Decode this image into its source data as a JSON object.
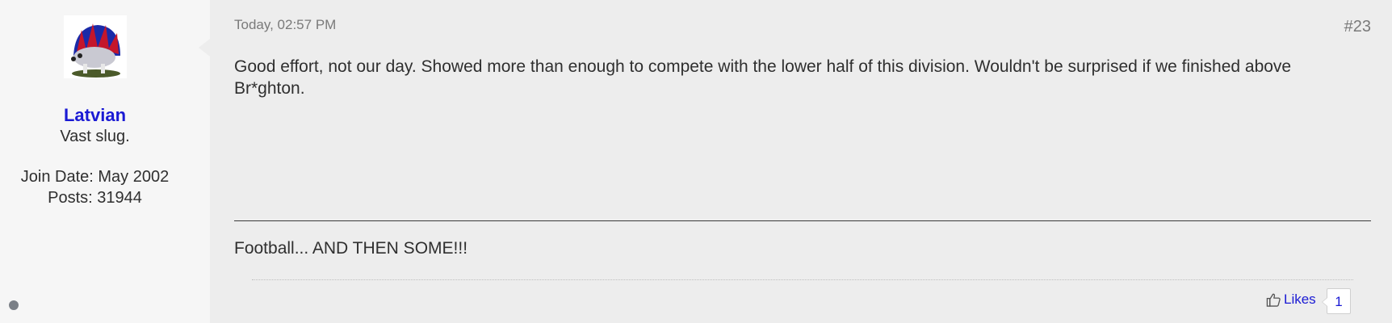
{
  "user": {
    "name": "Latvian",
    "title": "Vast slug.",
    "join_date": "Join Date: May 2002",
    "posts": "Posts: 31944",
    "avatar_icon": "hedgehog-avatar-icon",
    "status_icon": "offline-dot-icon"
  },
  "post": {
    "date": "Today, 02:57 PM",
    "number": "#23",
    "body": "Good effort, not our day. Showed more than enough to compete with the lower half of this division. Wouldn't be surprised if we finished above Br*ghton.",
    "signature": "Football... AND THEN SOME!!!"
  },
  "likes": {
    "label": "Likes",
    "count": "1",
    "icon": "thumbs-up-icon"
  },
  "colors": {
    "link": "#1a1ad4",
    "post_background": "#ededed",
    "userinfo_background": "#f6f6f6"
  }
}
